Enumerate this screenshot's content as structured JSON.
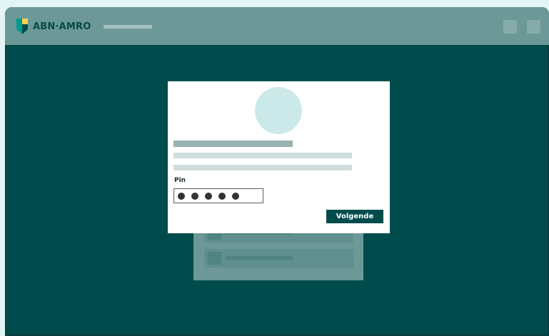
{
  "app": {
    "brand_name": "ABN·AMRO",
    "brand_logo_icon": "abn-amro-shield-icon",
    "colors": {
      "brand_dark_green": "#004c4c",
      "brand_yellow": "#f8d24a",
      "brand_teal": "#009b8f"
    }
  },
  "login_modal": {
    "pin_label": "Pin",
    "pin_digits_entered": 5,
    "submit_label": "Volgende"
  }
}
